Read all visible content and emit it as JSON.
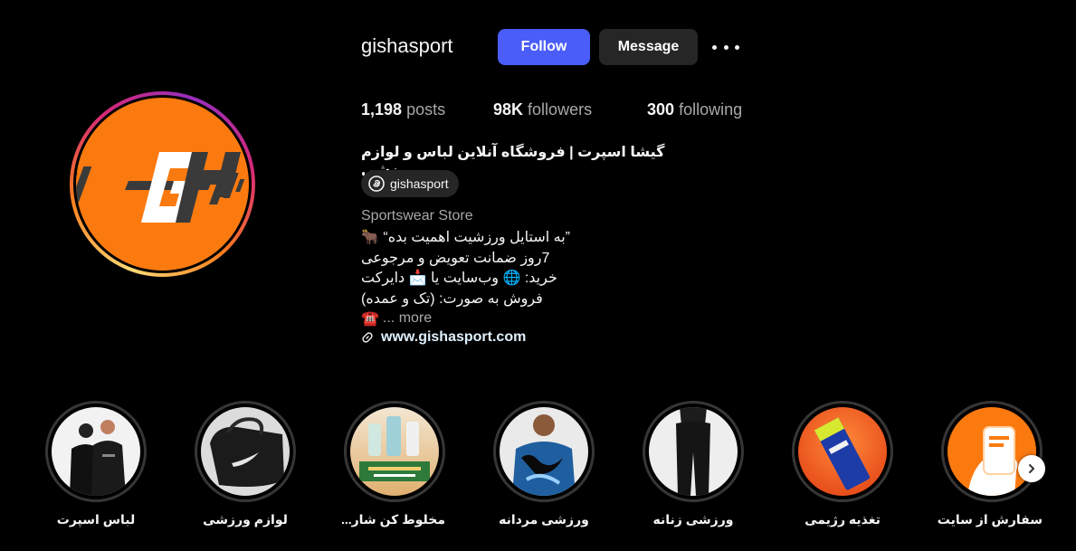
{
  "profile": {
    "username": "gishasport",
    "follow_label": "Follow",
    "message_label": "Message",
    "stats": {
      "posts_count": "1,198",
      "posts_label": "posts",
      "followers_count": "98K",
      "followers_label": "followers",
      "following_count": "300",
      "following_label": "following"
    },
    "full_name": "گیشا اسپرت | فروشگاه آنلاین لباس و لوازم ورزشی",
    "threads_handle": "gishasport",
    "category": "Sportswear Store",
    "bio_lines": [
      "”به استایل ورزشیت اهمیت بده“ 🐂",
      "7روز ضمانت تعویض و مرجوعی",
      "خرید: 🌐 وب‌سایت یا 📩 دایرکت",
      "فروش به صورت: (تک و عمده)"
    ],
    "bio_last_emoji": "☎️",
    "more_label": "... more",
    "website": "www.gishasport.com"
  },
  "highlights": [
    {
      "label": "لباس اسپرت"
    },
    {
      "label": "لوازم ورزشی"
    },
    {
      "label": "مخلوط کن شار..."
    },
    {
      "label": "ورزشی مردانه"
    },
    {
      "label": "ورزشی زنانه"
    },
    {
      "label": "تغذیه رژیمی"
    },
    {
      "label": "سفارش از سایت"
    }
  ],
  "colors": {
    "follow_button": "#4a5df9",
    "brand_orange": "#fb7a10",
    "background": "#000000"
  }
}
